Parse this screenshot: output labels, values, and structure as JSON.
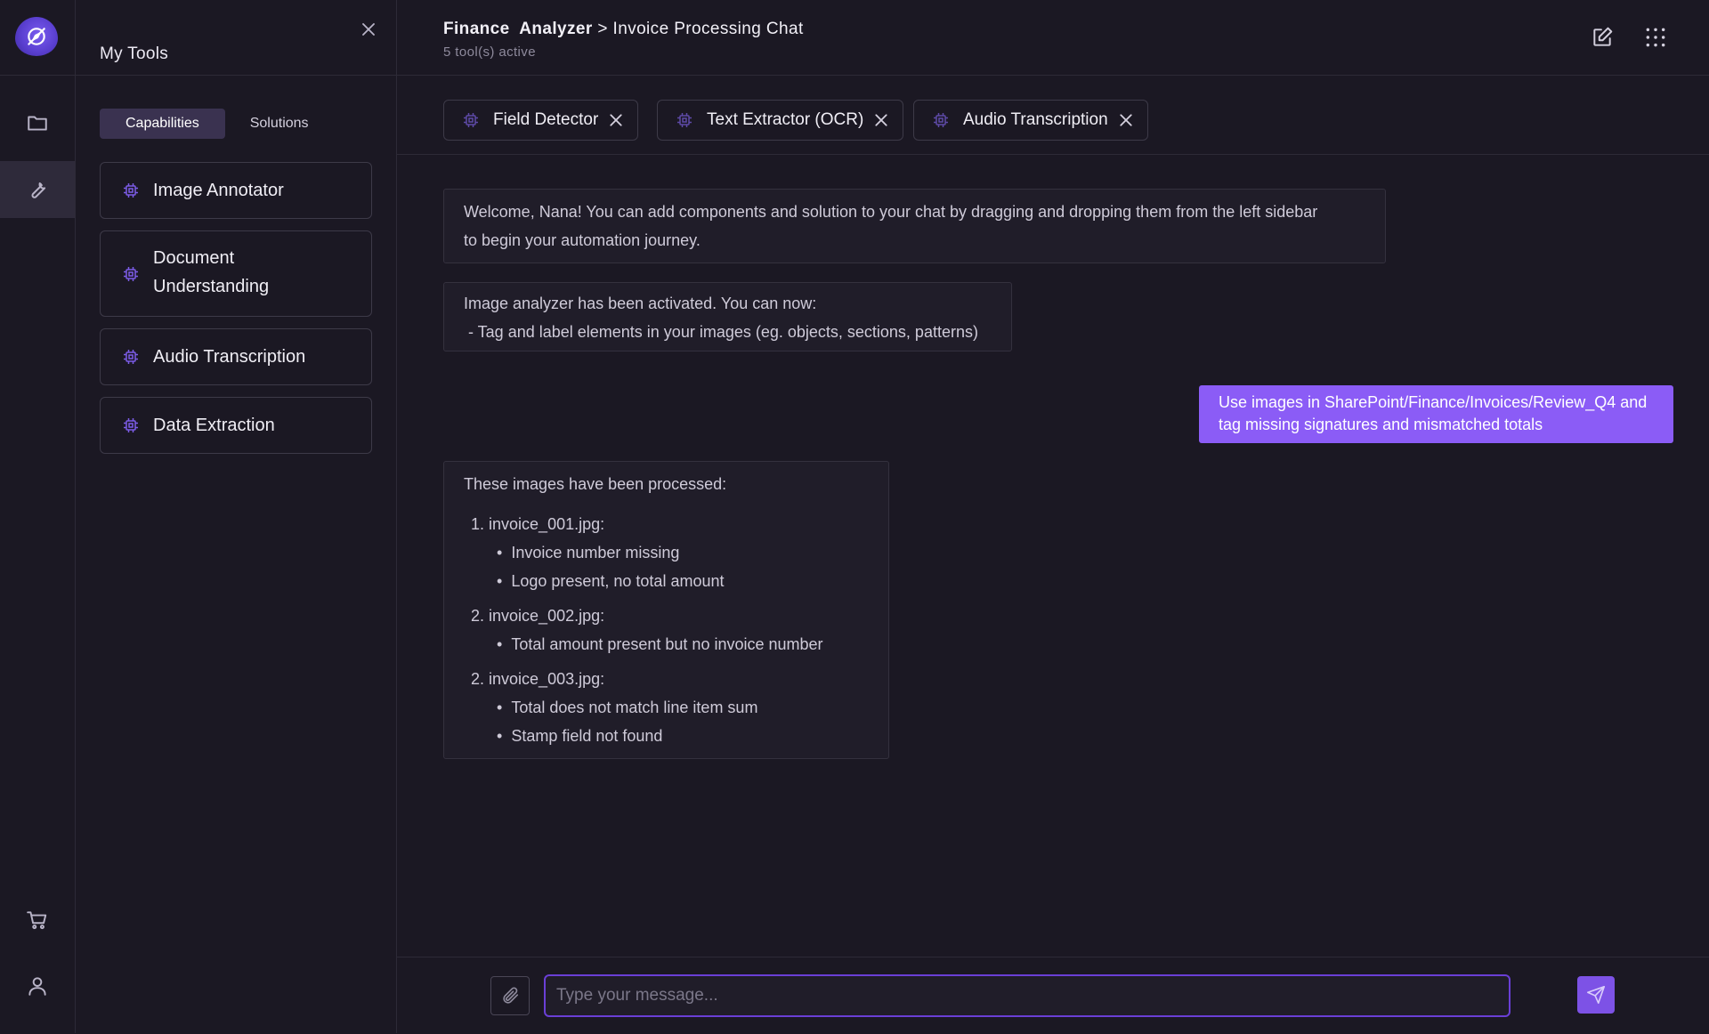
{
  "sidebar_rail": {
    "items": [
      {
        "name": "folder-icon"
      },
      {
        "name": "wrench-icon"
      },
      {
        "name": "cart-icon"
      },
      {
        "name": "user-icon"
      }
    ]
  },
  "tools_panel": {
    "title": "My Tools",
    "tabs": {
      "capabilities": "Capabilities",
      "solutions": "Solutions"
    },
    "cards": [
      {
        "label": "Image Annotator"
      },
      {
        "label_line1": "Document",
        "label_line2": "Understanding"
      },
      {
        "label": "Audio Transcription"
      },
      {
        "label": "Data Extraction"
      }
    ]
  },
  "header": {
    "breadcrumb_part1": "Finance",
    "breadcrumb_part2": "Analyzer",
    "separator": ">",
    "page": "Invoice Processing Chat",
    "subtitle": "5 tool(s) active"
  },
  "active_tools": [
    {
      "label": "Field Detector"
    },
    {
      "label": "Text Extractor (OCR)"
    },
    {
      "label": "Audio Transcription"
    }
  ],
  "messages": {
    "welcome_line1": "Welcome, Nana! You can add components and solution to your chat by dragging and dropping them from the left sidebar",
    "welcome_line2": "to begin your automation journey.",
    "activated_line1": "Image analyzer has been activated. You can now:",
    "activated_line2": " - Tag and label elements in your images (eg. objects, sections, patterns)",
    "user_line1": "Use images in SharePoint/Finance/Invoices/Review_Q4 and",
    "user_line2": "tag missing signatures and mismatched totals",
    "result_intro": "These images have been processed:",
    "results": [
      {
        "num": "1.",
        "file": "invoice_001.jpg:",
        "items": [
          "Invoice number missing",
          "Logo present, no total amount"
        ]
      },
      {
        "num": "2.",
        "file": "invoice_002.jpg:",
        "items": [
          "Total amount present but no invoice number"
        ]
      },
      {
        "num": "2.",
        "file": "invoice_003.jpg:",
        "items": [
          "Total does not match line item sum",
          "Stamp field not found"
        ]
      }
    ]
  },
  "composer": {
    "placeholder": "Type your message..."
  },
  "colors": {
    "accent": "#8b5cf6",
    "background": "#1b1823",
    "border": "#2d2a37",
    "icon_purple": "#7c5ce8"
  }
}
